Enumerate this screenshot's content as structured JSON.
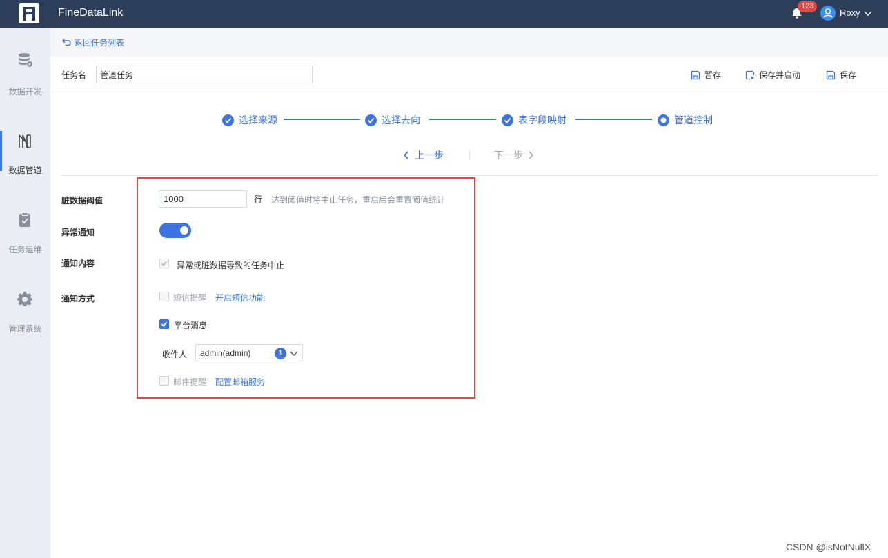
{
  "app": {
    "title": "FineDataLink"
  },
  "header": {
    "notification_count": "123",
    "user_name": "Roxy"
  },
  "sidebar": {
    "items": [
      {
        "label": "数据开发",
        "icon": "database-icon"
      },
      {
        "label": "数据管道",
        "icon": "pipeline-icon",
        "active": true
      },
      {
        "label": "任务运维",
        "icon": "clipboard-check-icon"
      },
      {
        "label": "管理系统",
        "icon": "gear-icon"
      }
    ]
  },
  "breadcrumb": {
    "back_label": "返回任务列表"
  },
  "task": {
    "name_label": "任务名",
    "name_value": "管道任务",
    "actions": {
      "draft": "暂存",
      "save_start": "保存并启动",
      "save": "保存"
    }
  },
  "steps": [
    {
      "label": "选择来源",
      "status": "done"
    },
    {
      "label": "选择去向",
      "status": "done"
    },
    {
      "label": "表字段映射",
      "status": "done"
    },
    {
      "label": "管道控制",
      "status": "current"
    }
  ],
  "step_nav": {
    "prev": "上一步",
    "next": "下一步"
  },
  "form": {
    "threshold": {
      "label": "脏数据阈值",
      "value": "1000",
      "unit": "行",
      "hint": "达到阈值时将中止任务，重启后会重置阈值统计"
    },
    "alert": {
      "label": "异常通知",
      "enabled": true
    },
    "content": {
      "label": "通知内容",
      "option": "异常或脏数据导致的任务中止"
    },
    "method": {
      "label": "通知方式",
      "sms": {
        "label": "短信提醒",
        "link": "开启短信功能"
      },
      "platform": {
        "label": "平台消息",
        "checked": true
      },
      "recipient": {
        "label": "收件人",
        "value": "admin(admin)",
        "count": "1"
      },
      "email": {
        "label": "邮件提醒",
        "link": "配置邮箱服务"
      }
    }
  },
  "watermark": "CSDN @isNotNullX",
  "colors": {
    "accent": "#3d74e0",
    "topbar": "#2c3e5a",
    "highlight": "#e84545"
  }
}
